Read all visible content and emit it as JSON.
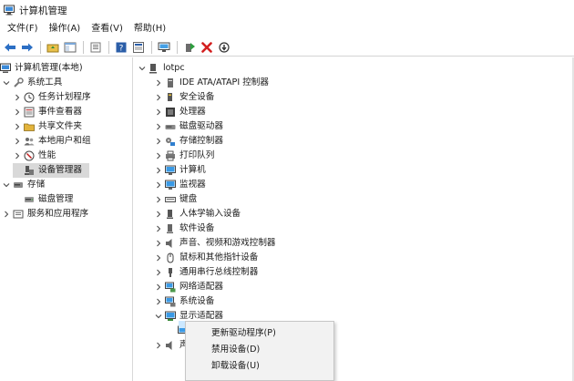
{
  "window": {
    "title": "计算机管理"
  },
  "menu": [
    "文件(F)",
    "操作(A)",
    "查看(V)",
    "帮助(H)"
  ],
  "toolbar": {
    "icons": [
      "back-arrow-icon",
      "forward-arrow-icon",
      "up-folder-icon",
      "show-hide-tree-icon",
      "export-list-icon",
      "help-icon",
      "properties-icon",
      "computer-monitor-icon",
      "update-driver-icon",
      "uninstall-x-icon",
      "disable-device-icon"
    ]
  },
  "tree": {
    "root": "计算机管理(本地)",
    "system_tools": "系统工具",
    "task_scheduler": "任务计划程序",
    "event_viewer": "事件查看器",
    "shared_folders": "共享文件夹",
    "local_users_groups": "本地用户和组",
    "performance": "性能",
    "device_manager": "设备管理器",
    "storage": "存储",
    "disk_management": "磁盘管理",
    "services_apps": "服务和应用程序"
  },
  "devices": {
    "computer_name": "lotpc",
    "categories": [
      "IDE ATA/ATAPI 控制器",
      "安全设备",
      "处理器",
      "磁盘驱动器",
      "存储控制器",
      "打印队列",
      "计算机",
      "监视器",
      "键盘",
      "人体学输入设备",
      "软件设备",
      "声音、视频和游戏控制器",
      "鼠标和其他指针设备",
      "通用串行总线控制器",
      "网络适配器",
      "系统设备",
      "显示适配器"
    ],
    "partial_next": "声"
  },
  "context_menu": {
    "update_driver": "更新驱动程序(P)",
    "disable_device": "禁用设备(D)",
    "uninstall_device": "卸载设备(U)"
  },
  "colors": {
    "selected_bg": "#d9d9d9",
    "highlight_bg": "#cce8ff",
    "menu_bg": "#f2f2f2"
  }
}
